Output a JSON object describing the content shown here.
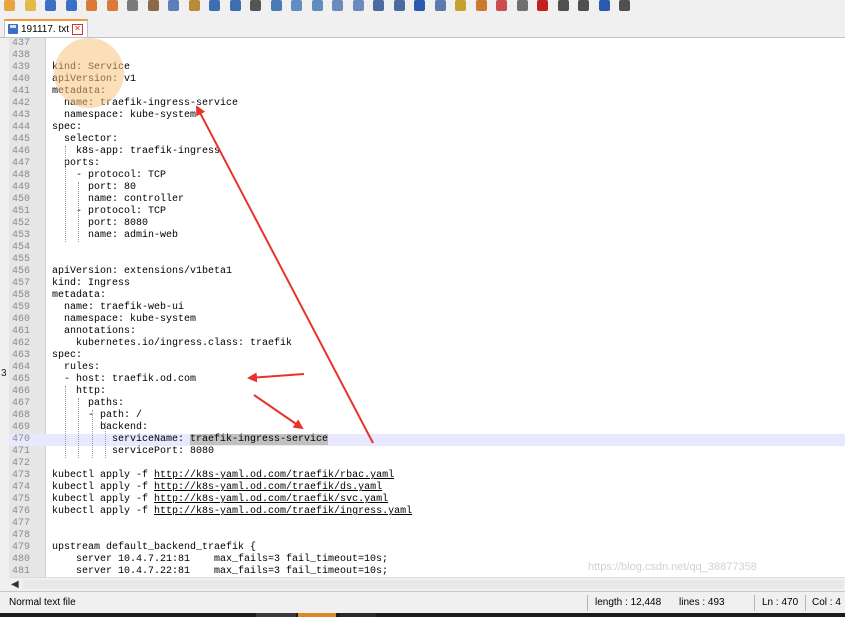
{
  "tab": {
    "filename": "191117. txt",
    "close_glyph": "✕"
  },
  "toolbar": {
    "icons": [
      {
        "name": "new-file-icon",
        "color": "#e5a640"
      },
      {
        "name": "open-file-icon",
        "color": "#e5b84a"
      },
      {
        "name": "save-icon",
        "color": "#3b6fc5"
      },
      {
        "name": "save-all-icon",
        "color": "#3b6fc5"
      },
      {
        "name": "close-icon",
        "color": "#d97a3a"
      },
      {
        "name": "close-all-icon",
        "color": "#d97a3a"
      },
      {
        "name": "print-icon",
        "color": "#7a7a7a"
      },
      {
        "name": "cut-icon",
        "color": "#8a6a4a"
      },
      {
        "name": "copy-icon",
        "color": "#5d7fb8"
      },
      {
        "name": "paste-icon",
        "color": "#b88a3a"
      },
      {
        "name": "undo-icon",
        "color": "#3d6fb0"
      },
      {
        "name": "redo-icon",
        "color": "#3d6fb0"
      },
      {
        "name": "find-icon",
        "color": "#555555"
      },
      {
        "name": "replace-icon",
        "color": "#4a7ab8"
      },
      {
        "name": "zoom-in-icon",
        "color": "#5f8fc0"
      },
      {
        "name": "zoom-out-icon",
        "color": "#5f8fc0"
      },
      {
        "name": "sync-vertical-icon",
        "color": "#6a8ac0"
      },
      {
        "name": "sync-horizontal-icon",
        "color": "#6a8ac0"
      },
      {
        "name": "word-wrap-icon",
        "color": "#4a6aa0"
      },
      {
        "name": "show-all-chars-icon",
        "color": "#4a6aa0"
      },
      {
        "name": "indent-guide-icon",
        "color": "#2a5ab0"
      },
      {
        "name": "doc-map-icon",
        "color": "#5a7ab0"
      },
      {
        "name": "function-list-icon",
        "color": "#c8a030"
      },
      {
        "name": "folder-workspace-icon",
        "color": "#c87a30"
      },
      {
        "name": "monitor-icon",
        "color": "#c85050"
      },
      {
        "name": "eye-icon",
        "color": "#707070"
      },
      {
        "name": "record-macro-icon",
        "color": "#c02020"
      },
      {
        "name": "stop-macro-icon",
        "color": "#505050"
      },
      {
        "name": "play-macro-icon",
        "color": "#505050"
      },
      {
        "name": "play-multiple-icon",
        "color": "#2a5ab0"
      },
      {
        "name": "save-macro-icon",
        "color": "#505050"
      }
    ]
  },
  "lines": [
    {
      "n": "437",
      "t": ""
    },
    {
      "n": "438",
      "t": ""
    },
    {
      "n": "439",
      "t": "kind: Service"
    },
    {
      "n": "440",
      "t": "apiVersion: v1"
    },
    {
      "n": "441",
      "t": "metadata:"
    },
    {
      "n": "442",
      "t": "  name: traefik-ingress-service"
    },
    {
      "n": "443",
      "t": "  namespace: kube-system"
    },
    {
      "n": "444",
      "t": "spec:"
    },
    {
      "n": "445",
      "t": "  selector:"
    },
    {
      "n": "446",
      "t": "    k8s-app: traefik-ingress"
    },
    {
      "n": "447",
      "t": "  ports:"
    },
    {
      "n": "448",
      "t": "    - protocol: TCP"
    },
    {
      "n": "449",
      "t": "      port: 80"
    },
    {
      "n": "450",
      "t": "      name: controller"
    },
    {
      "n": "451",
      "t": "    - protocol: TCP"
    },
    {
      "n": "452",
      "t": "      port: 8080"
    },
    {
      "n": "453",
      "t": "      name: admin-web"
    },
    {
      "n": "454",
      "t": ""
    },
    {
      "n": "455",
      "t": ""
    },
    {
      "n": "456",
      "t": "apiVersion: extensions/v1beta1"
    },
    {
      "n": "457",
      "t": "kind: Ingress"
    },
    {
      "n": "458",
      "t": "metadata:"
    },
    {
      "n": "459",
      "t": "  name: traefik-web-ui"
    },
    {
      "n": "460",
      "t": "  namespace: kube-system"
    },
    {
      "n": "461",
      "t": "  annotations:"
    },
    {
      "n": "462",
      "t": "    kubernetes.io/ingress.class: traefik"
    },
    {
      "n": "463",
      "t": "spec:"
    },
    {
      "n": "464",
      "t": "  rules:"
    },
    {
      "n": "465",
      "t": "  - host: traefik.od.com"
    },
    {
      "n": "466",
      "t": "    http:"
    },
    {
      "n": "467",
      "t": "      paths:"
    },
    {
      "n": "468",
      "t": "      - path: /"
    },
    {
      "n": "469",
      "t": "        backend:"
    },
    {
      "n": "470",
      "t": "          serviceName: ",
      "sel": "traefik-ingress-service",
      "hl": true
    },
    {
      "n": "471",
      "t": "          servicePort: 8080"
    },
    {
      "n": "472",
      "t": ""
    },
    {
      "n": "473",
      "t": "kubectl apply -f ",
      "link": "http://k8s-yaml.od.com/traefik/rbac.yaml"
    },
    {
      "n": "474",
      "t": "kubectl apply -f ",
      "link": "http://k8s-yaml.od.com/traefik/ds.yaml"
    },
    {
      "n": "475",
      "t": "kubectl apply -f ",
      "link": "http://k8s-yaml.od.com/traefik/svc.yaml"
    },
    {
      "n": "476",
      "t": "kubectl apply -f ",
      "link": "http://k8s-yaml.od.com/traefik/ingress.yaml"
    },
    {
      "n": "477",
      "t": ""
    },
    {
      "n": "478",
      "t": ""
    },
    {
      "n": "479",
      "t": "upstream default_backend_traefik {"
    },
    {
      "n": "480",
      "t": "    server 10.4.7.21:81    max_fails=3 fail_timeout=10s;"
    },
    {
      "n": "481",
      "t": "    server 10.4.7.22:81    max_fails=3 fail_timeout=10s;"
    }
  ],
  "status": {
    "file_type": "Normal text file",
    "length": "length : 12,448",
    "lines": "lines : 493",
    "ln": "Ln : 470",
    "col": "Col : 4"
  },
  "margin_mark": "3",
  "watermark": "https://blog.csdn.net/qq_38877358",
  "annotation_color": "#e8332b"
}
